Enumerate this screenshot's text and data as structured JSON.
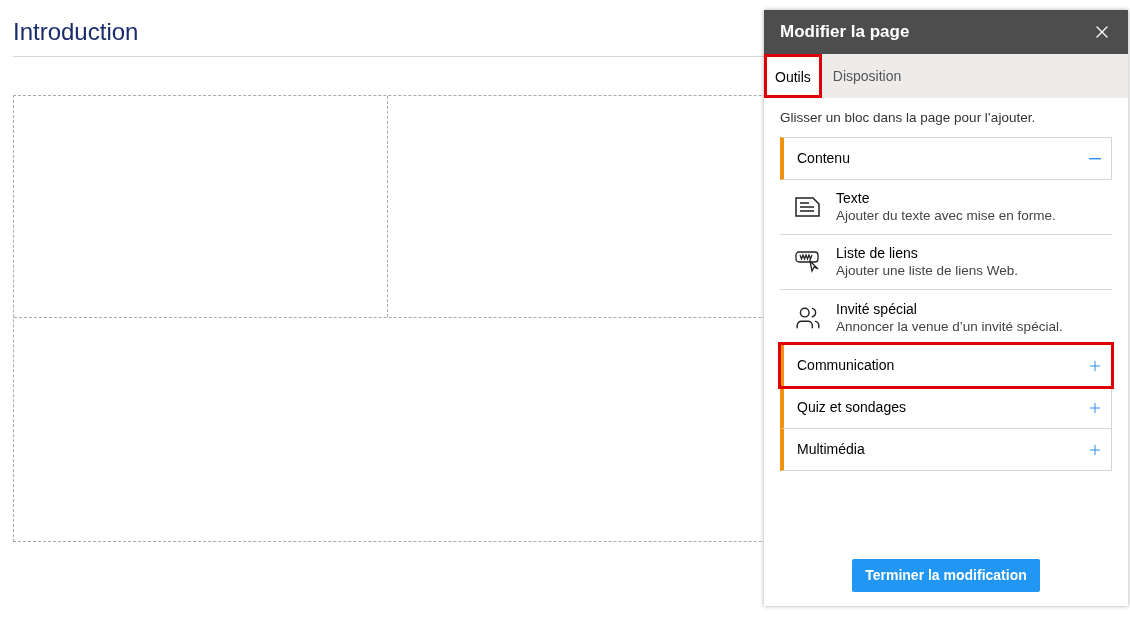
{
  "page": {
    "title": "Introduction"
  },
  "panel": {
    "title": "Modifier la page",
    "tabs": [
      {
        "label": "Outils",
        "selected": true,
        "highlighted": true
      },
      {
        "label": "Disposition",
        "selected": false,
        "highlighted": false
      }
    ],
    "hint": "Glisser un bloc dans la page pour l’ajouter.",
    "categories": [
      {
        "label": "Contenu",
        "expanded": true,
        "highlighted": false,
        "items": [
          {
            "kind": "text",
            "title": "Texte",
            "description": "Ajouter du texte avec mise en forme."
          },
          {
            "kind": "links",
            "title": "Liste de liens",
            "description": "Ajouter une liste de liens Web."
          },
          {
            "kind": "guest",
            "title": "Invité spécial",
            "description": "Annoncer la venue d’un invité spécial."
          }
        ]
      },
      {
        "label": "Communication",
        "expanded": false,
        "highlighted": true
      },
      {
        "label": "Quiz et sondages",
        "expanded": false,
        "highlighted": false
      },
      {
        "label": "Multimédia",
        "expanded": false,
        "highlighted": false
      }
    ],
    "finish_button": "Terminer la modification"
  }
}
